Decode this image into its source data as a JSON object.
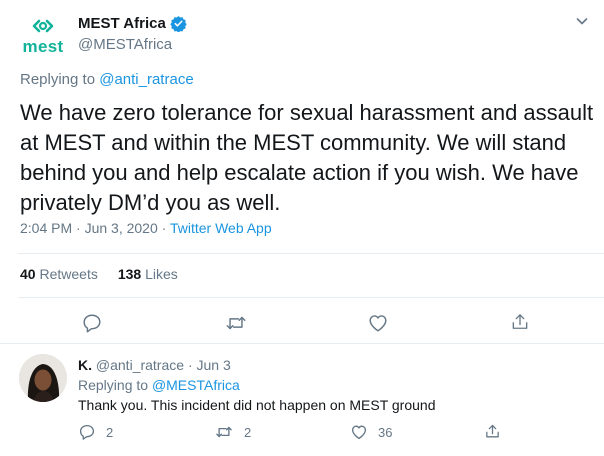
{
  "main_tweet": {
    "author": {
      "name": "MEST Africa",
      "handle": "@MESTAfrica",
      "logo_text": "mest",
      "verified": true
    },
    "replying_to_label": "Replying to",
    "replying_to_handle": "@anti_ratrace",
    "text": "We have zero tolerance for sexual harassment and assault at MEST and within the MEST community. We will stand behind you and help escalate action if you wish. We have privately DM’d you as well.",
    "time": "2:04 PM · Jun 3, 2020 · ",
    "source": "Twitter Web App",
    "stats": {
      "retweets_count": "40",
      "retweets_label": "Retweets",
      "likes_count": "138",
      "likes_label": "Likes"
    },
    "icons": {
      "reply": "reply-icon",
      "retweet": "retweet-icon",
      "like": "heart-icon",
      "share": "share-icon",
      "menu": "chevron-down-icon",
      "verified": "verified-badge-icon"
    }
  },
  "reply": {
    "author_name": "K.",
    "handle": "@anti_ratrace",
    "separator": "·",
    "date": "Jun 3",
    "replying_to_label": "Replying to",
    "replying_to_handle": "@MESTAfrica",
    "text": "Thank you. This incident did not happen on MEST ground",
    "actions": {
      "reply_count": "2",
      "retweet_count": "2",
      "like_count": "36"
    }
  },
  "colors": {
    "accent": "#1b95e0",
    "muted": "#657786",
    "text": "#14171a",
    "logo_green": "#12b39a",
    "divider": "#e6ecf0"
  }
}
